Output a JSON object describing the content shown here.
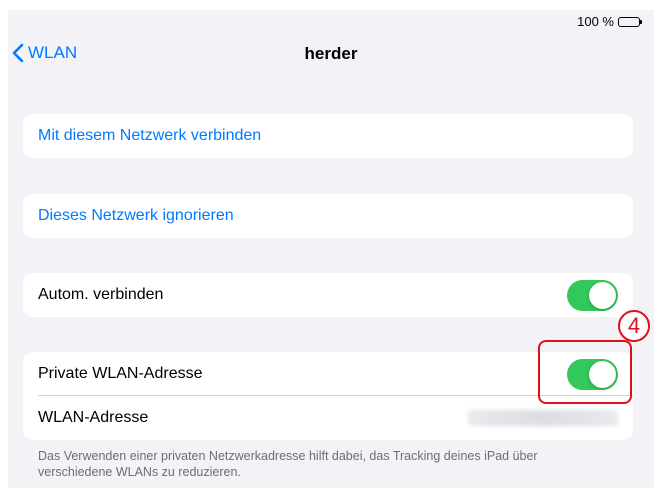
{
  "status_bar": {
    "battery_text": "100 %",
    "battery_icon": "battery-full-icon"
  },
  "nav": {
    "back_label": "WLAN",
    "title": "herder"
  },
  "actions": {
    "connect_label": "Mit diesem Netzwerk verbinden",
    "forget_label": "Dieses Netzwerk ignorieren"
  },
  "auto_join": {
    "label": "Autom. verbinden",
    "enabled": true
  },
  "private_address": {
    "label": "Private WLAN-Adresse",
    "enabled": true,
    "address_label": "WLAN-Adresse",
    "footer": "Das Verwenden einer privaten Netzwerkadresse hilft dabei, das Tracking deines iPad über verschiedene WLANs zu reduzieren."
  },
  "annotation": {
    "step_number": "4",
    "color": "#e0101a"
  },
  "colors": {
    "accent": "#007aff",
    "toggle_on": "#34c759",
    "background": "#f2f2f7"
  }
}
